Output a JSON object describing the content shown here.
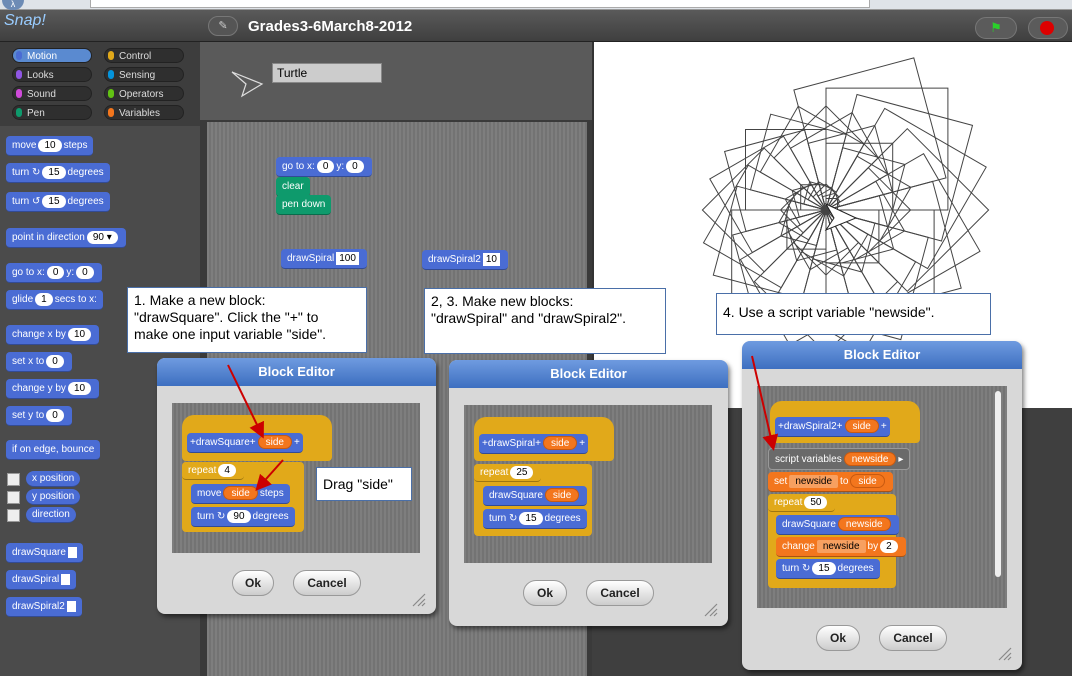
{
  "browser": {
    "back_symbol": "λ"
  },
  "app": {
    "logo_text": "Snap!",
    "project_title": "Grades3-6March8-2012",
    "sprite_name": "Turtle"
  },
  "categories": [
    {
      "label": "Motion",
      "color": "#4a6cd4"
    },
    {
      "label": "Control",
      "color": "#e1a91a"
    },
    {
      "label": "Looks",
      "color": "#8f56e3"
    },
    {
      "label": "Sensing",
      "color": "#0494dc"
    },
    {
      "label": "Sound",
      "color": "#cf4ad9"
    },
    {
      "label": "Operators",
      "color": "#62c213"
    },
    {
      "label": "Pen",
      "color": "#0e9a6c"
    },
    {
      "label": "Variables",
      "color": "#f3761d"
    }
  ],
  "palette": {
    "move": {
      "t1": "move",
      "v": "10",
      "t2": "steps"
    },
    "turn_cw": {
      "t1": "turn ↻",
      "v": "15",
      "t2": "degrees"
    },
    "turn_ccw": {
      "t1": "turn ↺",
      "v": "15",
      "t2": "degrees"
    },
    "point_dir": {
      "t1": "point in direction",
      "v": "90 ▾"
    },
    "goto": {
      "t1": "go to x:",
      "x": "0",
      "t2": "y:",
      "y": "0"
    },
    "glide": {
      "t1": "glide",
      "v": "1",
      "t2": "secs to x:"
    },
    "change_x": {
      "t1": "change x by",
      "v": "10"
    },
    "set_x": {
      "t1": "set x to",
      "v": "0"
    },
    "change_y": {
      "t1": "change y by",
      "v": "10"
    },
    "set_y": {
      "t1": "set y to",
      "v": "0"
    },
    "bounce": {
      "t1": "if on edge, bounce"
    },
    "xpos": "x position",
    "ypos": "y position",
    "direction": "direction",
    "draw_square": "drawSquare",
    "draw_spiral": "drawSpiral",
    "draw_spiral2": "drawSpiral2"
  },
  "script": {
    "goto": {
      "t1": "go to x:",
      "x": "0",
      "t2": "y:",
      "y": "0"
    },
    "clear": "clear",
    "pen_down": "pen down",
    "spiral": {
      "t1": "drawSpiral",
      "v": "100"
    },
    "spiral2": {
      "t1": "drawSpiral2",
      "v": "10"
    }
  },
  "callouts": {
    "c1": "1. Make a new block:\n\"drawSquare\". Click the \"+\" to\nmake one input variable \"side\".",
    "c2": "2, 3. Make new blocks:\n\"drawSpiral\" and \"drawSpiral2\".",
    "c3": "4. Use a script variable \"newside\".",
    "drag": "Drag \"side\""
  },
  "editors": {
    "title": "Block Editor",
    "ok": "Ok",
    "cancel": "Cancel",
    "e1": {
      "hat_name": "drawSquare",
      "param": "side",
      "plus": "+",
      "repeat": "repeat",
      "repeat_n": "4",
      "move": "move",
      "move_v": "side",
      "steps": "steps",
      "turn": "turn ↻",
      "turn_v": "90",
      "degrees": "degrees"
    },
    "e2": {
      "hat_name": "drawSpiral",
      "param": "side",
      "plus": "+",
      "repeat": "repeat",
      "repeat_n": "25",
      "draw": "drawSquare",
      "draw_v": "side",
      "turn": "turn ↻",
      "turn_v": "15",
      "degrees": "degrees"
    },
    "e3": {
      "hat_name": "drawSpiral2",
      "param": "side",
      "plus": "+",
      "script_vars": "script variables",
      "newside": "newside",
      "set": "set",
      "set_var": "newside",
      "to": "to",
      "set_v": "side",
      "repeat": "repeat",
      "repeat_n": "50",
      "draw": "drawSquare",
      "draw_v": "newside",
      "change": "change",
      "change_var": "newside",
      "by": "by",
      "change_v": "2",
      "turn": "turn ↻",
      "turn_v": "15",
      "degrees": "degrees"
    }
  },
  "colors": {
    "motion": "#4a6cd4",
    "pen": "#0e9a6c",
    "control": "#e1a91a",
    "variables": "#f3761d",
    "arrow": "#cc0000"
  }
}
